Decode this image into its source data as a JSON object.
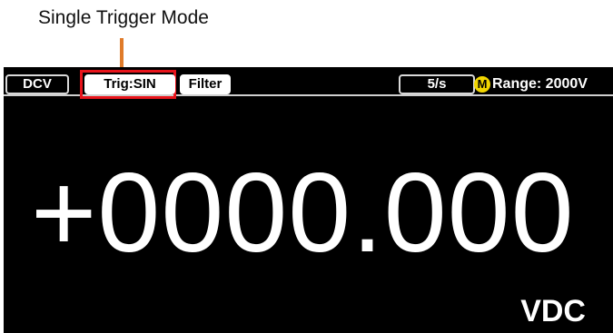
{
  "callout": {
    "label": "Single Trigger Mode",
    "line_color": "#e07b2a"
  },
  "status_bar": {
    "function": "DCV",
    "trigger": "Trig:SIN",
    "filter": "Filter",
    "rate": "5/s",
    "memory_icon": "M",
    "range": "Range: 2000V",
    "highlight_color": "#e8141b"
  },
  "display": {
    "reading": "+0000.000",
    "unit": "VDC"
  }
}
